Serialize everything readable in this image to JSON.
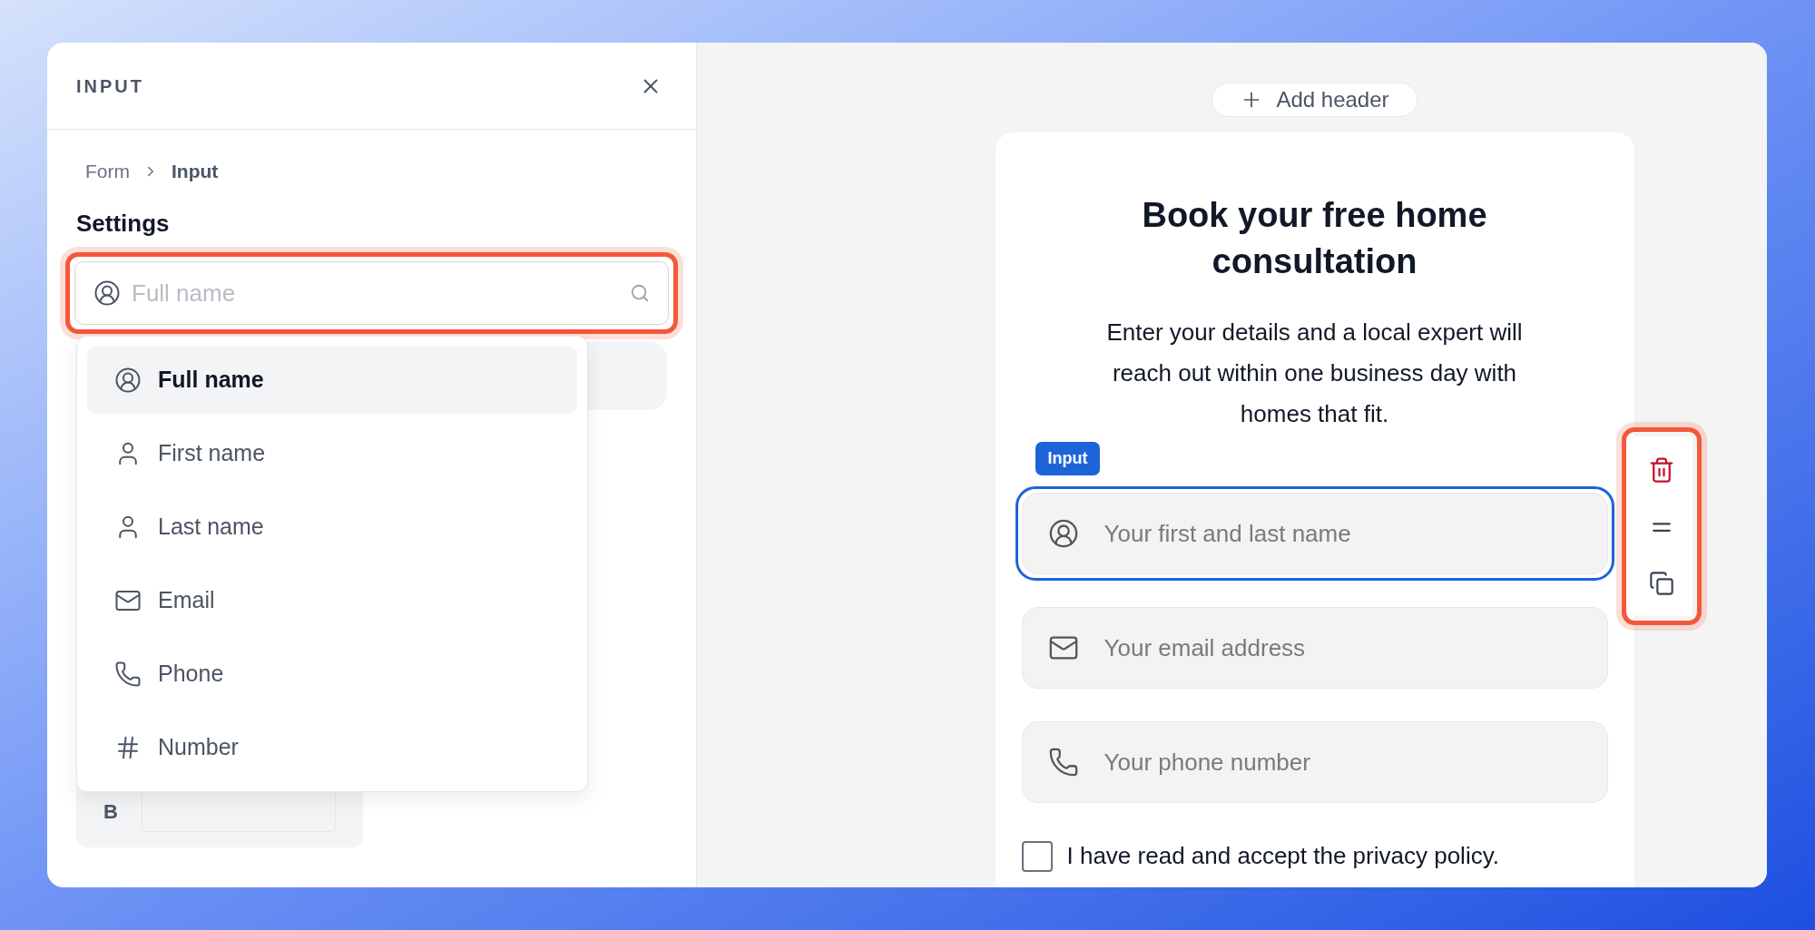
{
  "panel": {
    "title": "INPUT",
    "breadcrumb": [
      {
        "label": "Form",
        "current": false
      },
      {
        "label": "Input",
        "current": true
      }
    ],
    "section_title": "Settings",
    "search": {
      "placeholder": "Full name"
    },
    "options": [
      {
        "kind": "full-name",
        "label": "Full name",
        "selected": true
      },
      {
        "kind": "person",
        "label": "First name",
        "selected": false
      },
      {
        "kind": "person",
        "label": "Last name",
        "selected": false
      },
      {
        "kind": "email",
        "label": "Email",
        "selected": false
      },
      {
        "kind": "phone",
        "label": "Phone",
        "selected": false
      },
      {
        "kind": "number",
        "label": "Number",
        "selected": false
      }
    ],
    "hidden_row": {
      "label": "B"
    }
  },
  "canvas": {
    "add_header": "Add header",
    "form": {
      "title": "Book your free home consultation",
      "description": "Enter your details and a local expert will reach out within one business day with homes that fit.",
      "selected_badge": "Input",
      "fields": [
        {
          "kind": "full-name",
          "placeholder": "Your first and last name",
          "selected": true
        },
        {
          "kind": "email",
          "placeholder": "Your email address",
          "selected": false
        },
        {
          "kind": "phone",
          "placeholder": "Your phone number",
          "selected": false
        }
      ],
      "consent": {
        "label": "I have read and accept the privacy policy.",
        "checked": false
      }
    }
  }
}
